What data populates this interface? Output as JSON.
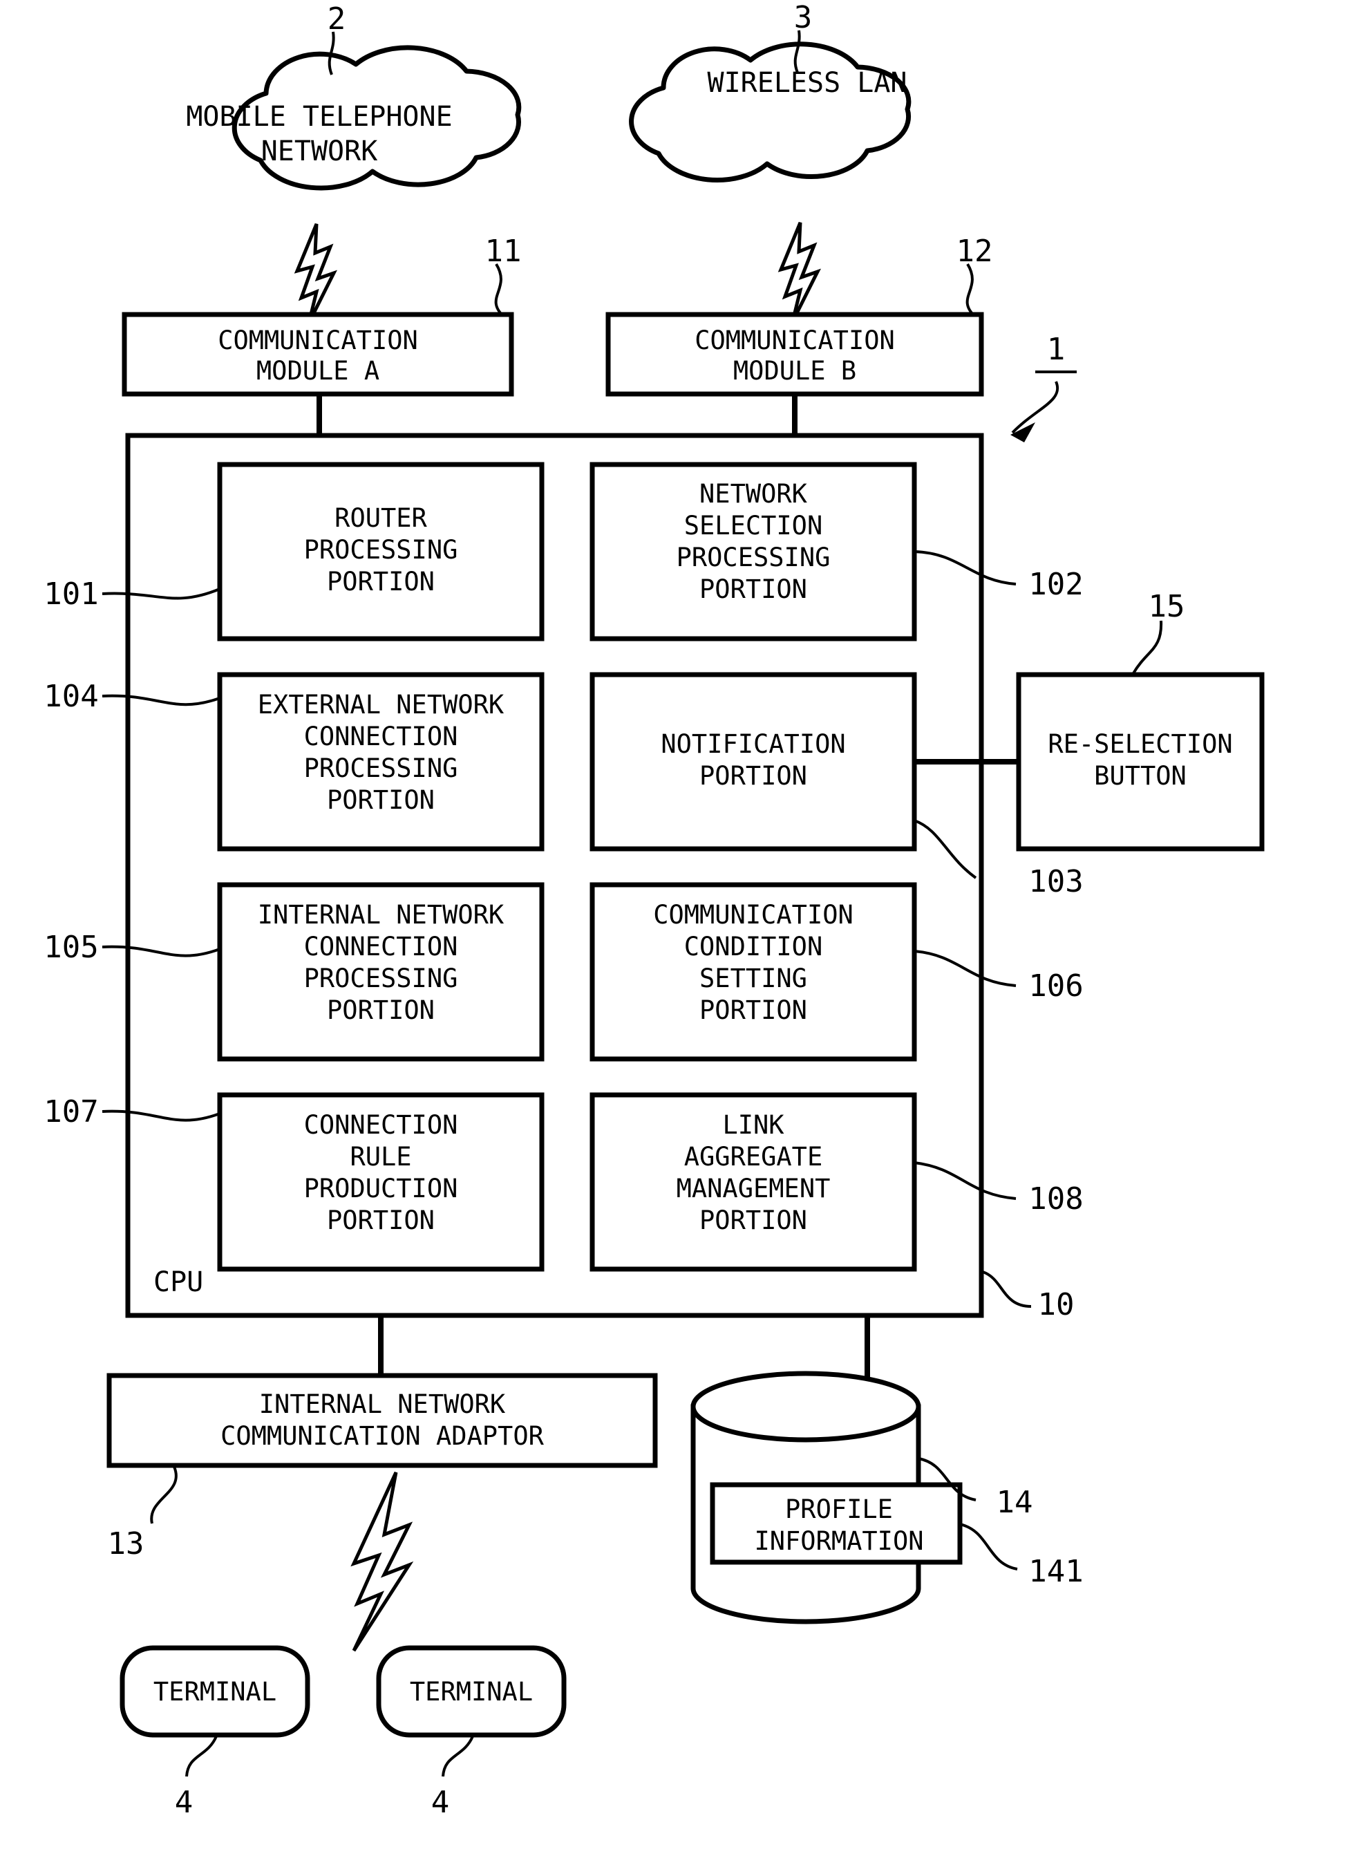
{
  "figure": {
    "type": "patent-block-diagram",
    "clouds": [
      {
        "id": "mobile-telephone-network",
        "lines": [
          "MOBILE TELEPHONE",
          "NETWORK"
        ],
        "ref": "2"
      },
      {
        "id": "wireless-lan",
        "lines": [
          "WIRELESS LAN"
        ],
        "ref": "3"
      }
    ],
    "modules": [
      {
        "id": "communication-module-a",
        "lines": [
          "COMMUNICATION",
          "MODULE A"
        ],
        "ref": "11"
      },
      {
        "id": "communication-module-b",
        "lines": [
          "COMMUNICATION",
          "MODULE B"
        ],
        "ref": "12"
      }
    ],
    "device": {
      "ref": "1"
    },
    "cpu": {
      "label": "CPU",
      "ref": "10"
    },
    "cpu_blocks": [
      {
        "id": "router-processing-portion",
        "lines": [
          "ROUTER",
          "PROCESSING",
          "PORTION"
        ],
        "ref": "101",
        "ref_side": "left"
      },
      {
        "id": "network-selection-processing-portion",
        "lines": [
          "NETWORK",
          "SELECTION",
          "PROCESSING",
          "PORTION"
        ],
        "ref": "102",
        "ref_side": "right"
      },
      {
        "id": "external-network-connection-processing-portion",
        "lines": [
          "EXTERNAL NETWORK",
          "CONNECTION",
          "PROCESSING",
          "PORTION"
        ],
        "ref": "104",
        "ref_side": "left"
      },
      {
        "id": "notification-portion",
        "lines": [
          "NOTIFICATION",
          "PORTION"
        ],
        "ref": "103",
        "ref_side": "right"
      },
      {
        "id": "internal-network-connection-processing-portion",
        "lines": [
          "INTERNAL NETWORK",
          "CONNECTION",
          "PROCESSING",
          "PORTION"
        ],
        "ref": "105",
        "ref_side": "left"
      },
      {
        "id": "communication-condition-setting-portion",
        "lines": [
          "COMMUNICATION",
          "CONDITION",
          "SETTING",
          "PORTION"
        ],
        "ref": "106",
        "ref_side": "right"
      },
      {
        "id": "connection-rule-production-portion",
        "lines": [
          "CONNECTION",
          "RULE",
          "PRODUCTION",
          "PORTION"
        ],
        "ref": "107",
        "ref_side": "left"
      },
      {
        "id": "link-aggregate-management-portion",
        "lines": [
          "LINK",
          "AGGREGATE",
          "MANAGEMENT",
          "PORTION"
        ],
        "ref": "108",
        "ref_side": "right"
      }
    ],
    "reselection_button": {
      "lines": [
        "RE-SELECTION",
        "BUTTON"
      ],
      "ref": "15"
    },
    "adaptor": {
      "lines": [
        "INTERNAL NETWORK",
        "COMMUNICATION ADAPTOR"
      ],
      "ref": "13"
    },
    "storage": {
      "ref": "14",
      "inner": {
        "lines": [
          "PROFILE",
          "INFORMATION"
        ],
        "ref": "141"
      }
    },
    "terminals": [
      {
        "id": "terminal-left",
        "label": "TERMINAL",
        "ref": "4"
      },
      {
        "id": "terminal-right",
        "label": "TERMINAL",
        "ref": "4"
      }
    ]
  },
  "text": {
    "cloud_mtn_l1": "MOBILE TELEPHONE",
    "cloud_mtn_l2": "NETWORK",
    "cloud_mtn_ref": "2",
    "cloud_wlan_l1": "WIRELESS LAN",
    "cloud_wlan_ref": "3",
    "mod_a_l1": "COMMUNICATION",
    "mod_a_l2": "MODULE A",
    "mod_a_ref": "11",
    "mod_b_l1": "COMMUNICATION",
    "mod_b_l2": "MODULE B",
    "mod_b_ref": "12",
    "device_ref": "1",
    "cpu_label": "CPU",
    "cpu_ref": "10",
    "b101_l1": "ROUTER",
    "b101_l2": "PROCESSING",
    "b101_l3": "PORTION",
    "b101_ref": "101",
    "b102_l1": "NETWORK",
    "b102_l2": "SELECTION",
    "b102_l3": "PROCESSING",
    "b102_l4": "PORTION",
    "b102_ref": "102",
    "b104_l1": "EXTERNAL NETWORK",
    "b104_l2": "CONNECTION",
    "b104_l3": "PROCESSING",
    "b104_l4": "PORTION",
    "b104_ref": "104",
    "b103_l1": "NOTIFICATION",
    "b103_l2": "PORTION",
    "b103_ref": "103",
    "b105_l1": "INTERNAL NETWORK",
    "b105_l2": "CONNECTION",
    "b105_l3": "PROCESSING",
    "b105_l4": "PORTION",
    "b105_ref": "105",
    "b106_l1": "COMMUNICATION",
    "b106_l2": "CONDITION",
    "b106_l3": "SETTING",
    "b106_l4": "PORTION",
    "b106_ref": "106",
    "b107_l1": "CONNECTION",
    "b107_l2": "RULE",
    "b107_l3": "PRODUCTION",
    "b107_l4": "PORTION",
    "b107_ref": "107",
    "b108_l1": "LINK",
    "b108_l2": "AGGREGATE",
    "b108_l3": "MANAGEMENT",
    "b108_l4": "PORTION",
    "b108_ref": "108",
    "btn_l1": "RE-SELECTION",
    "btn_l2": "BUTTON",
    "btn_ref": "15",
    "adaptor_l1": "INTERNAL NETWORK",
    "adaptor_l2": "COMMUNICATION ADAPTOR",
    "adaptor_ref": "13",
    "storage_ref": "14",
    "profile_l1": "PROFILE",
    "profile_l2": "INFORMATION",
    "profile_ref": "141",
    "terminal_left": "TERMINAL",
    "terminal_left_ref": "4",
    "terminal_right": "TERMINAL",
    "terminal_right_ref": "4"
  }
}
